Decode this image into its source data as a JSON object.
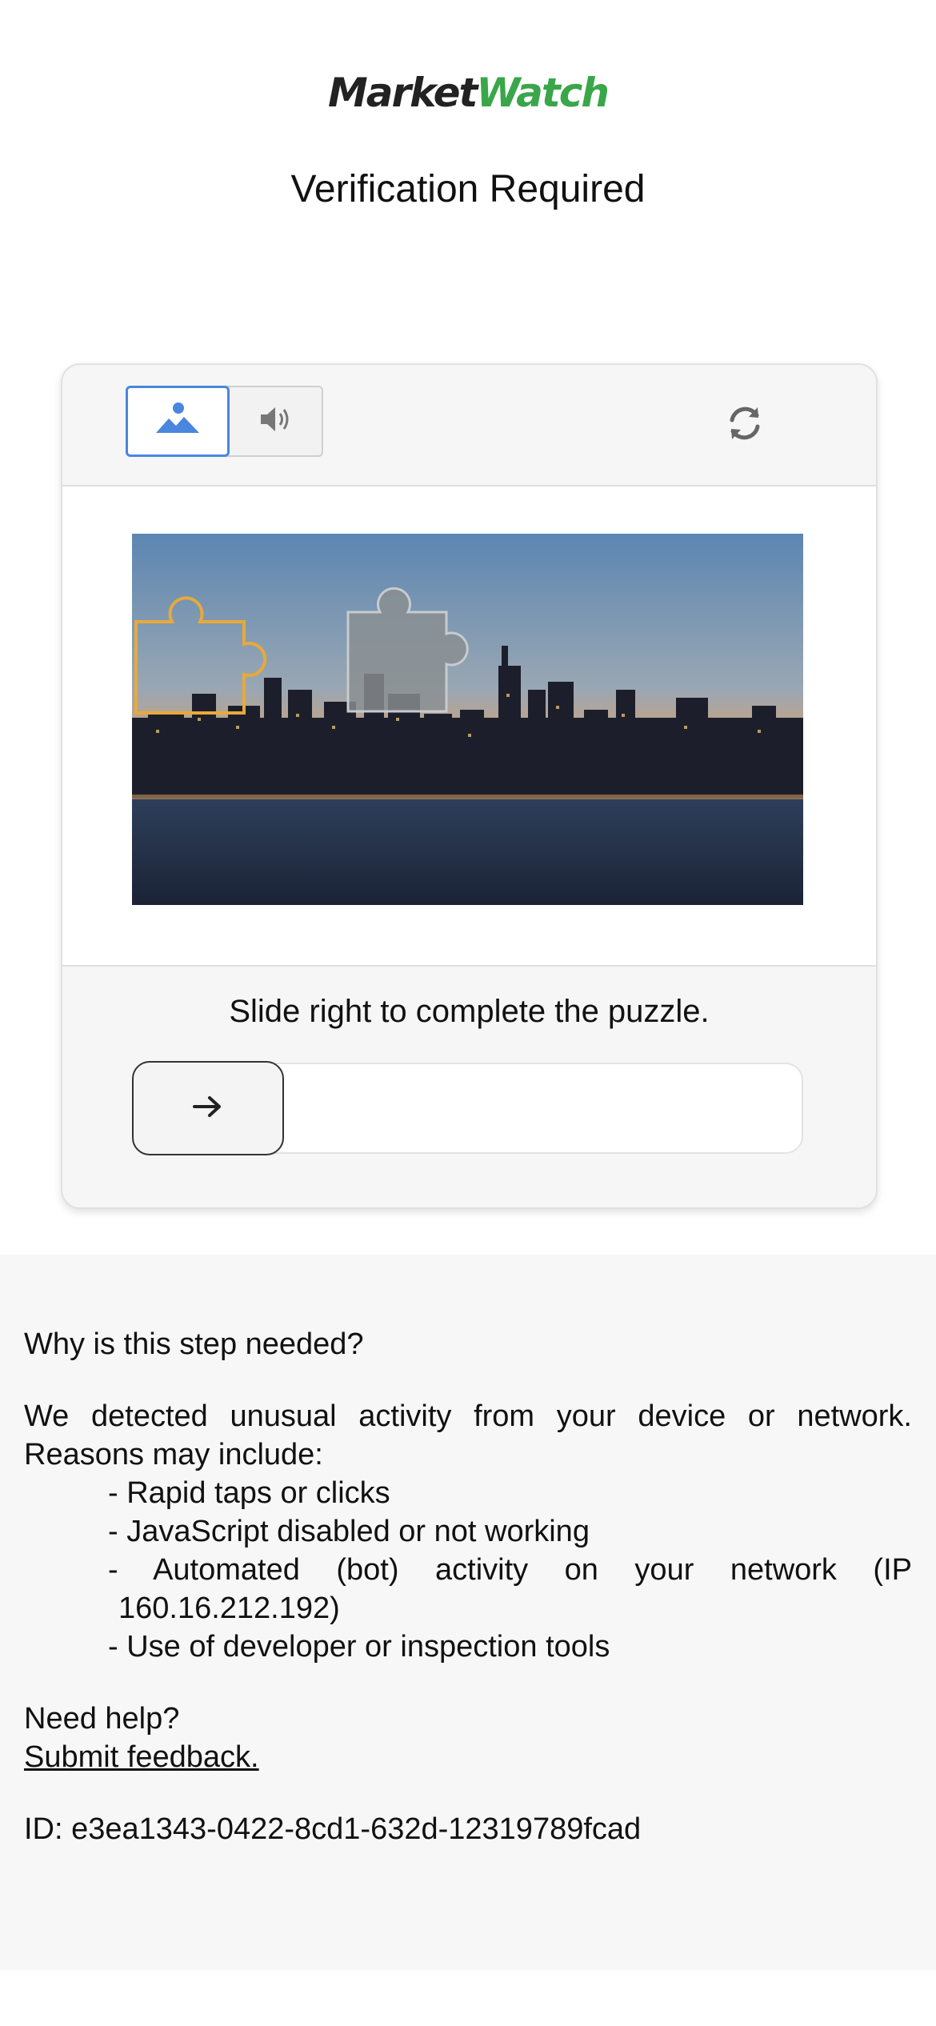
{
  "brand": {
    "part1": "Market",
    "part2": "Watch",
    "color_dark": "#222222",
    "color_green": "#3aa64a"
  },
  "page": {
    "title": "Verification Required"
  },
  "captcha": {
    "tabs": [
      {
        "name": "image",
        "icon": "mountain-image-icon",
        "selected": true
      },
      {
        "name": "audio",
        "icon": "speaker-icon",
        "selected": false
      }
    ],
    "refresh_icon": "refresh-icon",
    "instruction": "Slide right to complete the puzzle.",
    "slider_icon": "arrow-right-icon",
    "slider_progress": 0,
    "accent_color": "#4a86e0",
    "puzzle_outline_color": "#e8a93a"
  },
  "info": {
    "question": "Why is this step needed?",
    "explanation_line1": "We detected unusual activity from your device or network.",
    "explanation_line2": "Reasons may include:",
    "reasons": [
      "- Rapid taps or clicks",
      "- JavaScript disabled or not working",
      "- Automated (bot) activity on your network (IP",
      "160.16.212.192)",
      "- Use of developer or inspection tools"
    ],
    "help_label": "Need help?",
    "feedback_link": "Submit feedback.",
    "id_text": "ID: e3ea1343-0422-8cd1-632d-12319789fcad"
  }
}
